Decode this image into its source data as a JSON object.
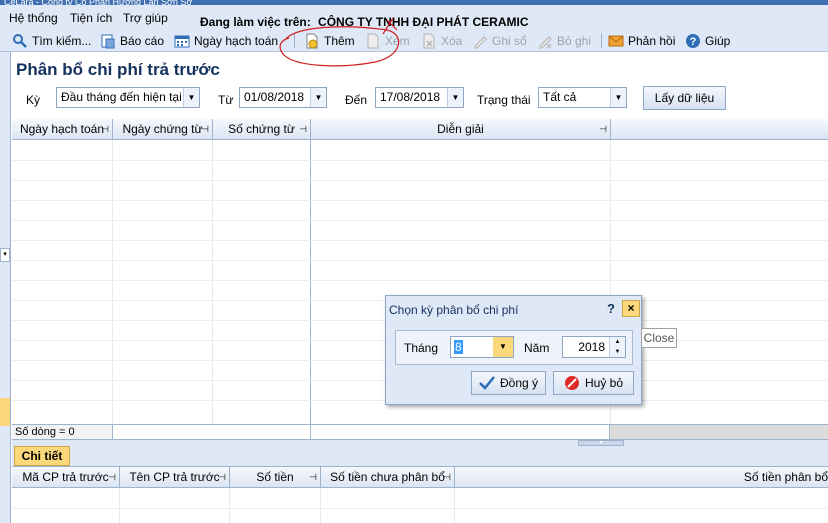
{
  "titlebar": {
    "text": "CeLara - Công ty Cổ Phần Hương Lan Sơn Sơ"
  },
  "menu": [
    "Hệ thống",
    "Tiện ích",
    "Trợ giúp"
  ],
  "workspace": {
    "label": "Đang làm việc trên:",
    "company": "CÔNG TY TNHH ĐẠI PHÁT CERAMIC"
  },
  "toolbar": {
    "search": "Tìm kiếm...",
    "report": "Báo cáo",
    "posting_date": "Ngày hạch toán",
    "add": "Thêm",
    "view": "Xem",
    "delete": "Xóa",
    "post": "Ghi sổ",
    "unpost": "Bỏ ghi",
    "feedback": "Phản hồi",
    "help": "Giúp"
  },
  "page": {
    "title": "Phân bổ chi phí trả trước"
  },
  "filters": {
    "period_label": "Kỳ",
    "period_value": "Đầu tháng đến hiện tại",
    "from_label": "Từ",
    "from_value": "01/08/2018",
    "to_label": "Đến",
    "to_value": "17/08/2018",
    "status_label": "Trạng thái",
    "status_value": "Tất cả",
    "fetch_button": "Lấy dữ liệu"
  },
  "grid": {
    "columns": [
      "Ngày hạch toán",
      "Ngày chứng từ",
      "Số chứng từ",
      "Diễn giải"
    ],
    "row_count": "Số dòng = 0"
  },
  "detail": {
    "tab": "Chi tiết",
    "columns": [
      "Mã CP trả trước",
      "Tên CP trả trước",
      "Số tiền",
      "Số tiền chưa phân bổ",
      "Số tiền phân bổ"
    ]
  },
  "dialog": {
    "title": "Chọn kỳ phân bổ chi phí",
    "help": "?",
    "close": "×",
    "month_label": "Tháng",
    "month_value": "8",
    "year_label": "Năm",
    "year_value": "2018",
    "ok_button": "Đồng ý",
    "cancel_button": "Huỷ bỏ"
  },
  "tooltip": {
    "text": "Close"
  },
  "colors": {
    "accent": "#15315e",
    "toolbar_bg": "#dfe8f6",
    "highlight": "#fbd97a",
    "annotation": "#d21f1f"
  }
}
